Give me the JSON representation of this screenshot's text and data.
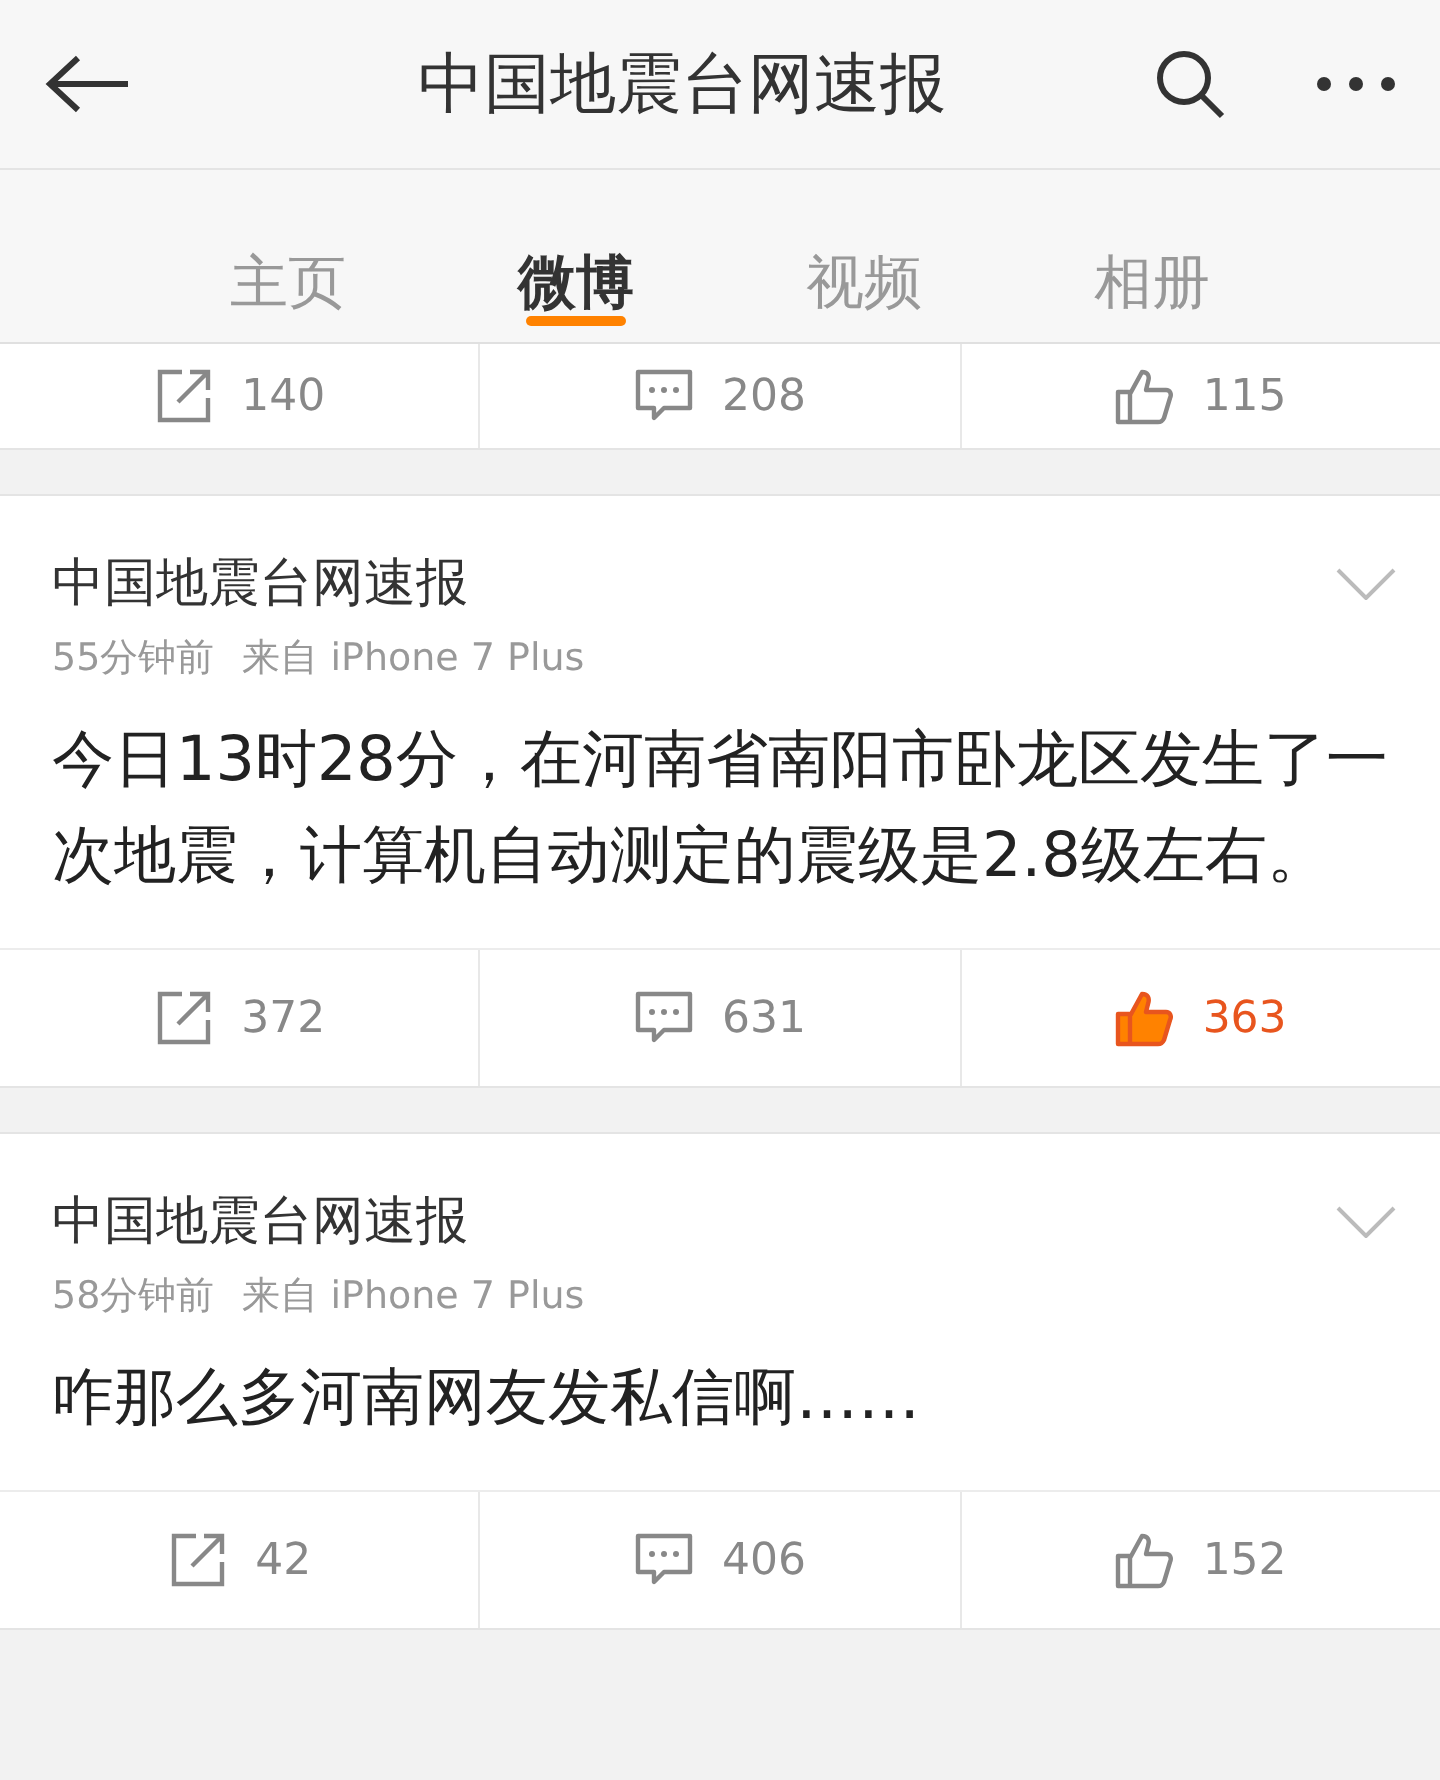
{
  "header": {
    "title": "中国地震台网速报"
  },
  "tabs": [
    {
      "label": "主页",
      "selected": false
    },
    {
      "label": "微博",
      "selected": true
    },
    {
      "label": "视频",
      "selected": false
    },
    {
      "label": "相册",
      "selected": false
    }
  ],
  "feed": [
    {
      "kind": "actions",
      "reposts": "140",
      "comments": "208",
      "likes": "115",
      "liked": false
    },
    {
      "kind": "post",
      "author": "中国地震台网速报",
      "time": "55分钟前",
      "source": "来自 iPhone 7 Plus",
      "text": "今日13时28分，在河南省南阳市卧龙区发生了一次地震，计算机自动测定的震级是2.8级左右。",
      "reposts": "372",
      "comments": "631",
      "likes": "363",
      "liked": true
    },
    {
      "kind": "post",
      "author": "中国地震台网速报",
      "time": "58分钟前",
      "source": "来自 iPhone 7 Plus",
      "text": "咋那么多河南网友发私信啊……",
      "reposts": "42",
      "comments": "406",
      "likes": "152",
      "liked": false
    }
  ]
}
